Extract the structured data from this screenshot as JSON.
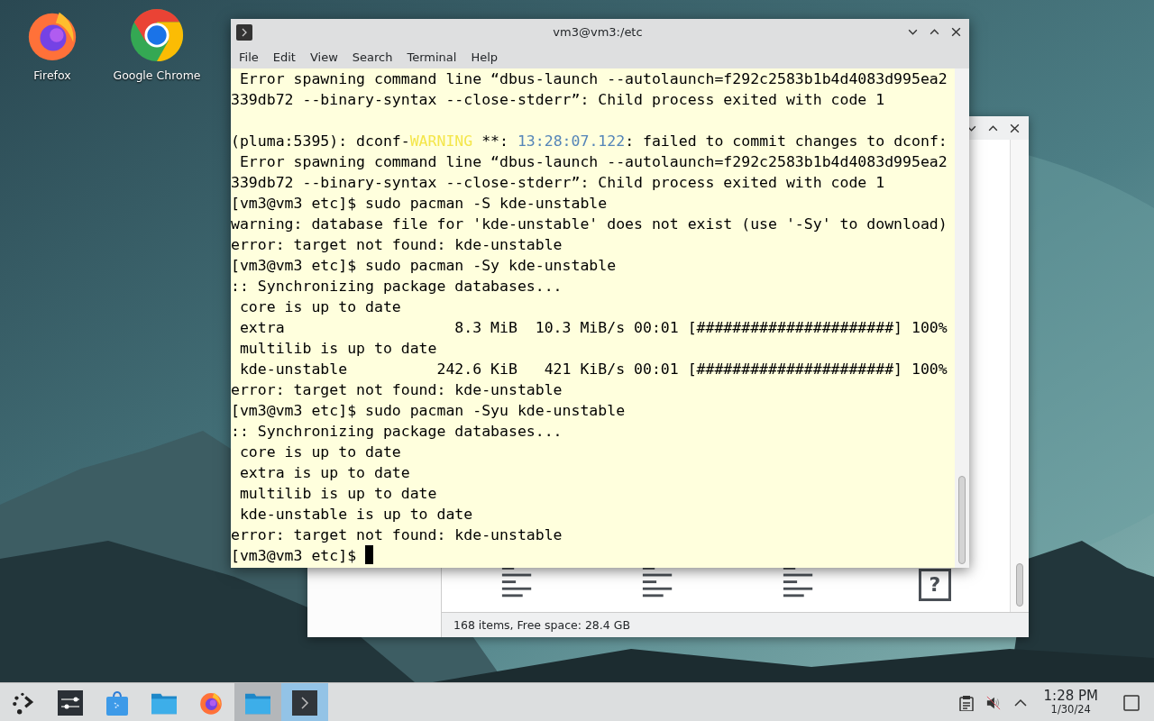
{
  "desktop_icons": [
    {
      "kind": "firefox",
      "label": "Firefox"
    },
    {
      "kind": "chrome",
      "label": "Google Chrome"
    }
  ],
  "file_manager": {
    "files": [
      {
        "kind": "text"
      },
      {
        "kind": "text"
      },
      {
        "kind": "text"
      },
      {
        "kind": "unknown",
        "glyph": "?"
      }
    ],
    "status": "168 items, Free space: 28.4 GB"
  },
  "terminal": {
    "title": "vm3@vm3:/etc",
    "menu": [
      "File",
      "Edit",
      "View",
      "Search",
      "Terminal",
      "Help"
    ],
    "lines": [
      {
        "text": " Error spawning command line “dbus-launch --autolaunch=f292c2583b1b4d4083d995ea2"
      },
      {
        "text": "339db72 --binary-syntax --close-stderr”: Child process exited with code 1"
      },
      {
        "blank_line_before": true,
        "segments": [
          {
            "kind": "plain",
            "text": "(pluma:5395): dconf-"
          },
          {
            "kind": "warning",
            "text": "WARNING"
          },
          {
            "kind": "plain",
            "text": " **: "
          },
          {
            "kind": "timestamp",
            "text": "13:28:07.122"
          },
          {
            "kind": "plain",
            "text": ": failed to commit changes to dconf:"
          }
        ]
      },
      {
        "text": " Error spawning command line “dbus-launch --autolaunch=f292c2583b1b4d4083d995ea2"
      },
      {
        "text": "339db72 --binary-syntax --close-stderr”: Child process exited with code 1"
      },
      {
        "text": "[vm3@vm3 etc]$ sudo pacman -S kde-unstable"
      },
      {
        "text": "warning: database file for 'kde-unstable' does not exist (use '-Sy' to download)"
      },
      {
        "text": "error: target not found: kde-unstable"
      },
      {
        "text": "[vm3@vm3 etc]$ sudo pacman -Sy kde-unstable"
      },
      {
        "text": ":: Synchronizing package databases..."
      },
      {
        "text": " core is up to date"
      },
      {
        "text": " extra                   8.3 MiB  10.3 MiB/s 00:01 [######################] 100%"
      },
      {
        "text": " multilib is up to date"
      },
      {
        "text": " kde-unstable          242.6 KiB   421 KiB/s 00:01 [######################] 100%"
      },
      {
        "text": "error: target not found: kde-unstable"
      },
      {
        "text": "[vm3@vm3 etc]$ sudo pacman -Syu kde-unstable"
      },
      {
        "text": ":: Synchronizing package databases..."
      },
      {
        "text": " core is up to date"
      },
      {
        "text": " extra is up to date"
      },
      {
        "text": " multilib is up to date"
      },
      {
        "text": " kde-unstable is up to date"
      },
      {
        "text": "error: target not found: kde-unstable"
      },
      {
        "text": "[vm3@vm3 etc]$ ",
        "cursor": true
      }
    ]
  },
  "taskbar": {
    "tasks": [
      {
        "kind": "launcher",
        "open": false,
        "selected": false
      },
      {
        "kind": "settings",
        "open": false,
        "selected": false
      },
      {
        "kind": "store",
        "open": false,
        "selected": false
      },
      {
        "kind": "folder",
        "open": false,
        "selected": false
      },
      {
        "kind": "firefox",
        "open": false,
        "selected": false
      },
      {
        "kind": "folder",
        "open": true,
        "selected": false
      },
      {
        "kind": "terminal",
        "open": true,
        "selected": true
      }
    ],
    "volume_muted": true,
    "clock": {
      "time": "1:28 PM",
      "date": "1/30/24"
    }
  }
}
